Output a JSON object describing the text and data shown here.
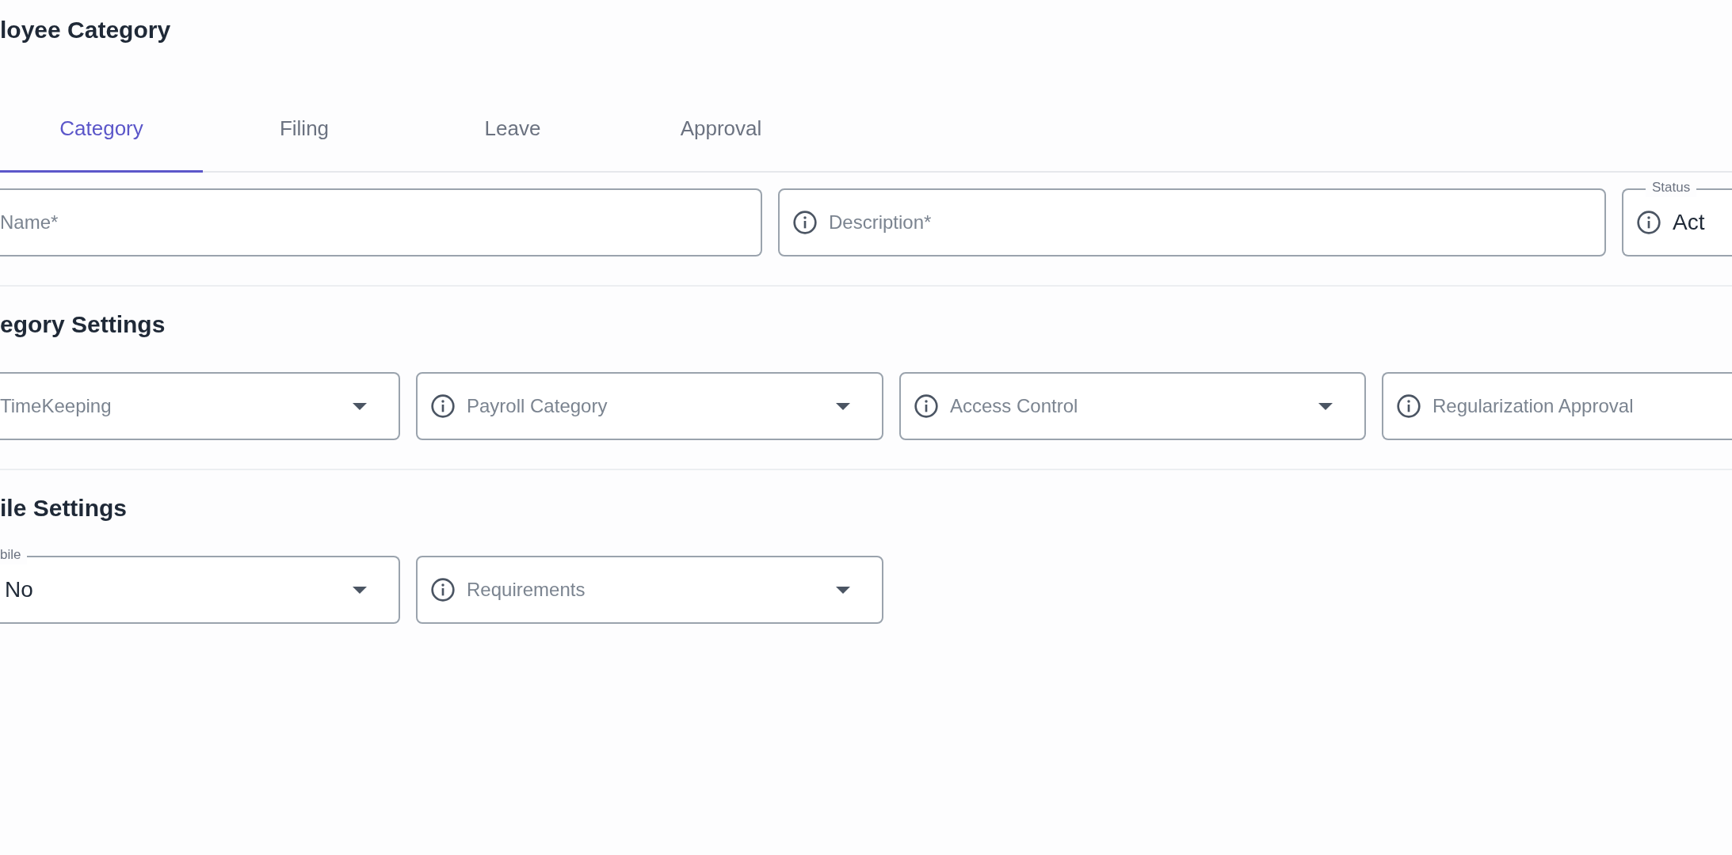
{
  "page": {
    "title": "loyee Category"
  },
  "tabs": [
    {
      "label": "Category",
      "selected": true
    },
    {
      "label": "Filing",
      "selected": false
    },
    {
      "label": "Leave",
      "selected": false
    },
    {
      "label": "Approval",
      "selected": false
    }
  ],
  "sections": [
    {
      "fields": [
        {
          "placeholder": "Name*",
          "info_icon": false,
          "arrow": false
        },
        {
          "placeholder": "Description*",
          "info_icon": true,
          "arrow": false
        },
        {
          "label": "Status",
          "value": "Act",
          "info_icon": true,
          "arrow": false
        }
      ]
    },
    {
      "heading": "egory Settings",
      "fields": [
        {
          "placeholder": "TimeKeeping",
          "info_icon": false,
          "arrow": true
        },
        {
          "placeholder": "Payroll Category",
          "info_icon": true,
          "arrow": true
        },
        {
          "placeholder": "Access Control",
          "info_icon": true,
          "arrow": true
        },
        {
          "placeholder": "Regularization Approval",
          "info_icon": true,
          "arrow": false
        }
      ]
    },
    {
      "heading": "ile Settings",
      "fields": [
        {
          "label": "bile",
          "value": "No",
          "info_icon": false,
          "arrow": true
        },
        {
          "placeholder": "Requirements",
          "info_icon": true,
          "arrow": true
        }
      ]
    }
  ]
}
